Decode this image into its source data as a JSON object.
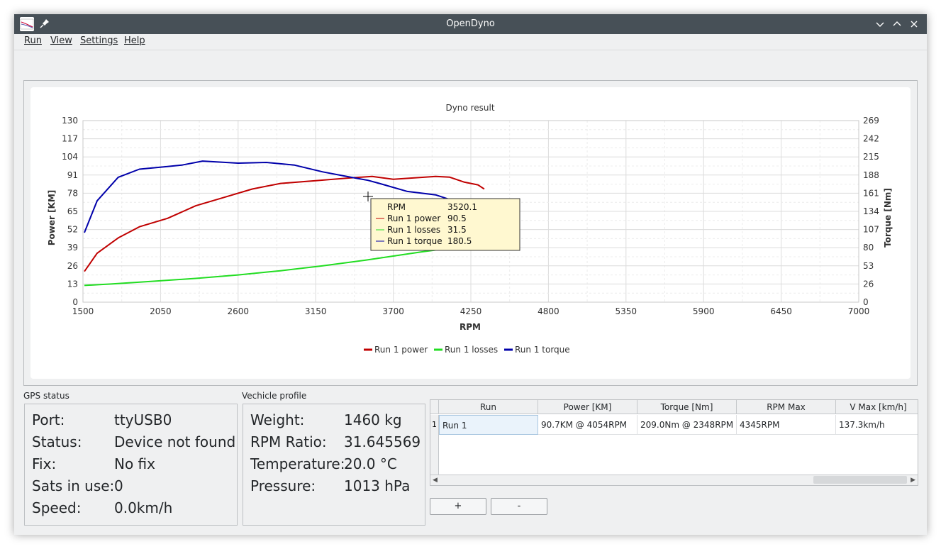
{
  "window": {
    "title": "OpenDyno"
  },
  "menu": {
    "items": [
      "Run",
      "View",
      "Settings",
      "Help"
    ]
  },
  "chart_data": {
    "type": "line",
    "title": "Dyno result",
    "xlabel": "RPM",
    "ylabel": "Power [KM]",
    "y2label": "Torque [Nm]",
    "xlim": [
      1500,
      7000
    ],
    "ylim": [
      0,
      130
    ],
    "y2lim": [
      0,
      269
    ],
    "x_ticks": [
      "1500",
      "2050",
      "2600",
      "3150",
      "3700",
      "4250",
      "4800",
      "5350",
      "5900",
      "6450",
      "7000"
    ],
    "y_ticks": [
      "0",
      "13",
      "26",
      "39",
      "52",
      "65",
      "78",
      "91",
      "104",
      "117",
      "130"
    ],
    "y2_ticks": [
      "0",
      "26",
      "53",
      "80",
      "107",
      "134",
      "161",
      "188",
      "215",
      "242",
      "269"
    ],
    "grid": true,
    "legend": "bottom",
    "series": [
      {
        "name": "Run 1 power",
        "axis": "left",
        "color": "#c00000",
        "x": [
          1510,
          1600,
          1750,
          1900,
          2100,
          2300,
          2500,
          2700,
          2900,
          3150,
          3400,
          3550,
          3700,
          3850,
          4000,
          4100,
          4200,
          4300,
          4345
        ],
        "y": [
          22,
          35,
          46,
          54,
          60,
          69,
          75,
          81,
          85,
          87,
          89,
          90,
          88,
          89,
          90,
          89.5,
          86,
          84,
          81
        ]
      },
      {
        "name": "Run 1 losses",
        "axis": "left",
        "color": "#22dd22",
        "x": [
          1510,
          1700,
          2000,
          2300,
          2600,
          2900,
          3200,
          3500,
          3700,
          3900,
          4050,
          4200
        ],
        "y": [
          12,
          13,
          15,
          17,
          19.5,
          22.5,
          26,
          30,
          33,
          36,
          38,
          40
        ]
      },
      {
        "name": "Run 1 torque",
        "axis": "right",
        "color": "#0000aa",
        "x": [
          1510,
          1600,
          1750,
          1900,
          2100,
          2200,
          2348,
          2600,
          2800,
          3000,
          3200,
          3400,
          3520,
          3600,
          3800,
          4000,
          4100,
          4200
        ],
        "y": [
          103,
          150,
          185,
          197,
          201,
          203,
          209,
          206,
          207,
          203,
          193,
          185,
          180.5,
          176,
          164,
          159,
          152,
          145
        ]
      }
    ]
  },
  "tooltip": {
    "rows": [
      {
        "label": "RPM",
        "value": "3520.1",
        "color": ""
      },
      {
        "label": "Run 1 power",
        "value": "90.5",
        "color": "#c00000"
      },
      {
        "label": "Run 1 losses",
        "value": "31.5",
        "color": "#22dd22"
      },
      {
        "label": "Run 1 torque",
        "value": "180.5",
        "color": "#0000aa"
      }
    ]
  },
  "gps": {
    "title": "GPS status",
    "rows": [
      {
        "label": "Port:",
        "value": "ttyUSB0"
      },
      {
        "label": "Status:",
        "value": "Device not found"
      },
      {
        "label": "Fix:",
        "value": "No fix"
      },
      {
        "label": "Sats in use:",
        "value": "0"
      },
      {
        "label": "Speed:",
        "value": "0.0km/h"
      }
    ]
  },
  "vehicle": {
    "title": "Vechicle profile",
    "rows": [
      {
        "label": "Weight:",
        "value": "1460 kg"
      },
      {
        "label": "RPM Ratio:",
        "value": "31.645569"
      },
      {
        "label": "Temperature:",
        "value": "20.0 °C"
      },
      {
        "label": "Pressure:",
        "value": "1013 hPa"
      }
    ]
  },
  "table": {
    "headers": [
      "Run",
      "Power [KM]",
      "Torque [Nm]",
      "RPM Max",
      "V Max [km/h]"
    ],
    "rows": [
      {
        "num": "1",
        "cells": [
          "Run 1",
          "90.7KM @ 4054RPM",
          "209.0Nm @ 2348RPM",
          "4345RPM",
          "137.3km/h"
        ]
      }
    ]
  },
  "buttons": {
    "add": "+",
    "remove": "-"
  }
}
